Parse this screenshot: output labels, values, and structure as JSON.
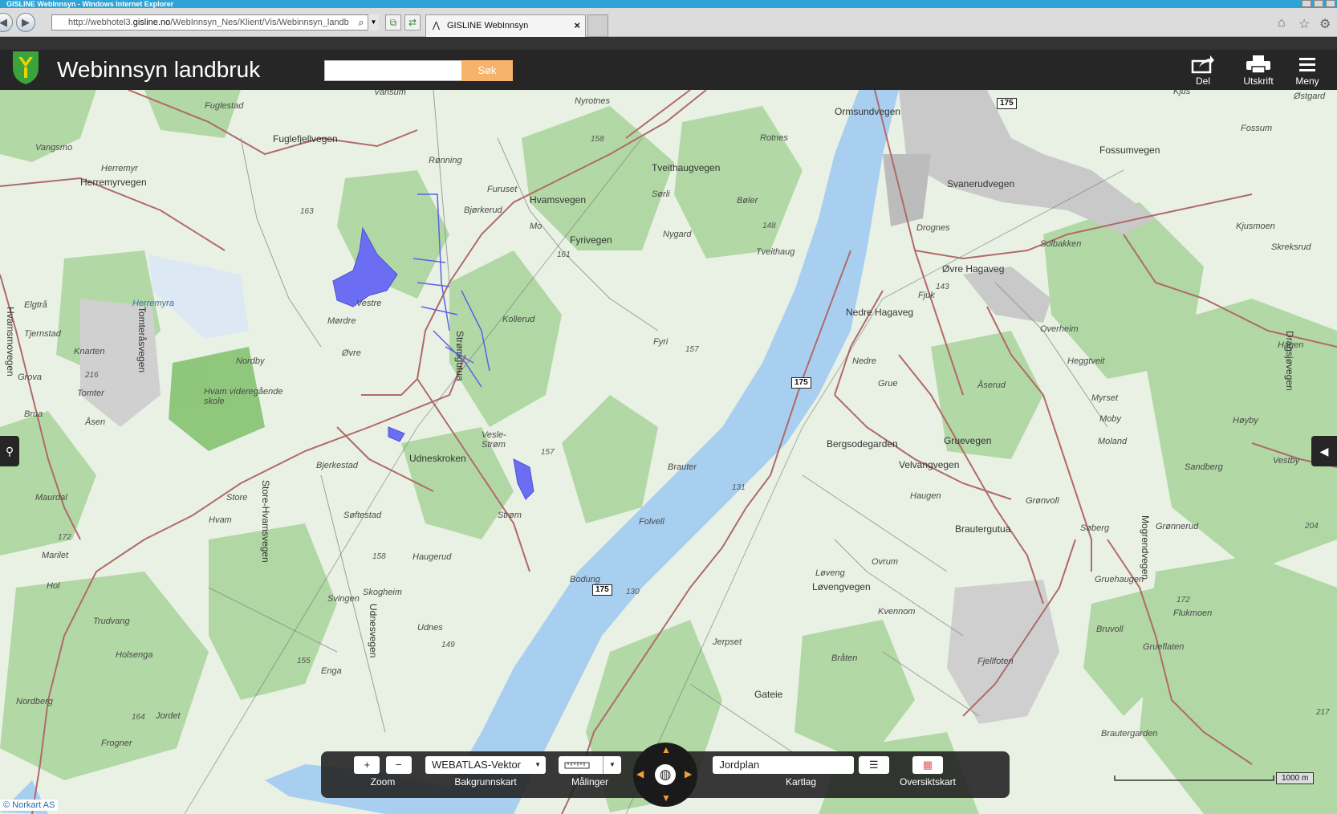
{
  "window": {
    "title": "GISLINE WebInnsyn - Windows Internet Explorer"
  },
  "browser": {
    "address_prefix": "http://webhotel3.",
    "address_host": "gisline.no",
    "address_rest": "/WebInnsyn_Nes/Klient/Vis/Webinnsyn_landb",
    "tab_title": "GISLINE WebInnsyn",
    "tab_close": "×"
  },
  "header": {
    "title": "Webinnsyn landbruk",
    "search_placeholder": "",
    "search_button": "Søk",
    "actions": [
      {
        "id": "del",
        "label": "Del",
        "icon": "share-icon"
      },
      {
        "id": "utskrift",
        "label": "Utskrift",
        "icon": "printer-icon"
      },
      {
        "id": "meny",
        "label": "Meny",
        "icon": "hamburger-menu-icon"
      }
    ]
  },
  "map": {
    "place_labels": [
      "Fuglestad",
      "Vansum",
      "Nyrotnes",
      "Vangsmo",
      "Herremyr",
      "Herremyrvegen",
      "Fuglefjellvegen",
      "Rønning",
      "Furuset",
      "Hvamsvegen",
      "Tveithaugvegen",
      "Rotnes",
      "Sørli",
      "Bøler",
      "Nygard",
      "Tveithaug",
      "Bjørkerud",
      "Fyrivegen",
      "Mo",
      "Herremyra",
      "Elgtrå",
      "Vestre",
      "Mørdre",
      "Kollerud",
      "Fyri",
      "Tjernstad",
      "Knarten",
      "Nordby",
      "Øvre",
      "Tomter",
      "Hvam videregående skole",
      "Grova",
      "Brua",
      "Åsen",
      "Vesle-Strøm",
      "Udneskroken",
      "Bjerkestad",
      "Strøm",
      "Brauter",
      "Store",
      "Søftestad",
      "Hvam",
      "Maurdal",
      "Marilet",
      "Haugerud",
      "Skogheim",
      "Svingen",
      "Udnes",
      "Holsenga",
      "Trudvang",
      "Hol",
      "Enga",
      "Nordberg",
      "Jordet",
      "Frogner",
      "Folvell",
      "Bodung",
      "Jerpset",
      "Løveng",
      "Kvennom",
      "Bråten",
      "Gateie",
      "Ormsundvegen",
      "Svanerudvegen",
      "Drognes",
      "Solbakken",
      "Fossum",
      "Fossumvegen",
      "Kjus",
      "Østgard",
      "Kjusmoen",
      "Skreksrud",
      "Fjuk",
      "Øvre Hagaveg",
      "Nedre Hagaveg",
      "Overheim",
      "Heggtveit",
      "Hagen",
      "Nedre",
      "Grue",
      "Åserud",
      "Myrset",
      "Moby",
      "Høyby",
      "Gruevegen",
      "Bergsodegarden",
      "Velvangvegen",
      "Haugen",
      "Grønvoll",
      "Moland",
      "Sandberg",
      "Vestby",
      "Søberg",
      "Grønnerud",
      "Brautergutua",
      "Ovrum",
      "Løvengvegen",
      "Gruehaugen",
      "Bruvoll",
      "Fjellfoten",
      "Grueflaten",
      "Flukmoen",
      "Brautergarden",
      "Dragsjøvegen",
      "Udnesvegen",
      "Strømgutua",
      "Store-Hvamsvegen",
      "Tomteråsvegen",
      "Hvamsmovegen",
      "Mogrendvegen"
    ],
    "route_shields": [
      "175",
      "175",
      "175"
    ],
    "elevations": [
      "163",
      "158",
      "161",
      "148",
      "143",
      "157",
      "216",
      "157",
      "131",
      "172",
      "158",
      "149",
      "155",
      "164",
      "130",
      "204",
      "172",
      "217"
    ]
  },
  "toolbar": {
    "zoom_label": "Zoom",
    "zoom_in": "+",
    "zoom_out": "−",
    "basemap_value": "WEBATLAS-Vektor",
    "basemap_label": "Bakgrunnskart",
    "measure_label": "Målinger",
    "layer_value": "Jordplan",
    "layer_label": "Kartlag",
    "overview_label": "Oversiktskart"
  },
  "scale": {
    "label": "1000 m"
  },
  "copyright": "© Norkart AS",
  "colors": {
    "header_bg": "#262626",
    "accent": "#f6b36b",
    "water": "#a9cff0",
    "forest": "#a8d49a",
    "logo_green": "#3aa33a",
    "logo_yellow": "#f3d000"
  }
}
